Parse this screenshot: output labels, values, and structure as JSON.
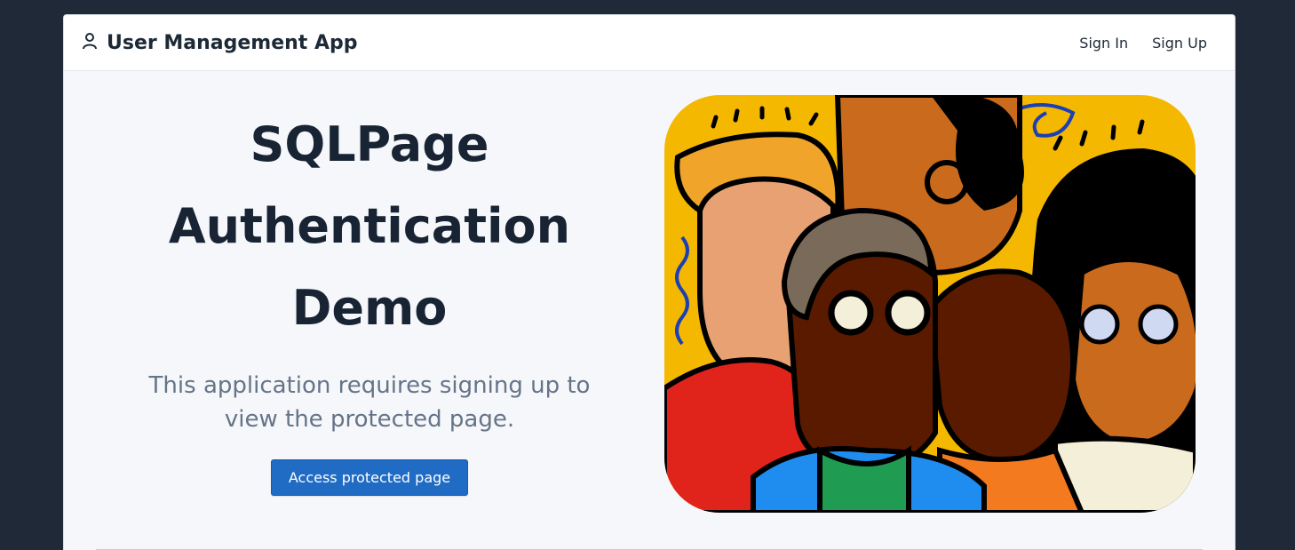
{
  "navbar": {
    "app_title": "User Management App",
    "brand_icon": "user-icon",
    "links": [
      {
        "label": "Sign In"
      },
      {
        "label": "Sign Up"
      }
    ]
  },
  "hero": {
    "title_lines": [
      "SQLPage",
      "Authentication",
      "Demo"
    ],
    "description": "This application requires signing up to view the protected page.",
    "button_label": "Access protected page",
    "illustration": "group-of-people-illustration"
  },
  "colors": {
    "background_dark": "#1f2937",
    "accent": "#206bc4",
    "heading": "#182433",
    "muted": "#667487"
  }
}
